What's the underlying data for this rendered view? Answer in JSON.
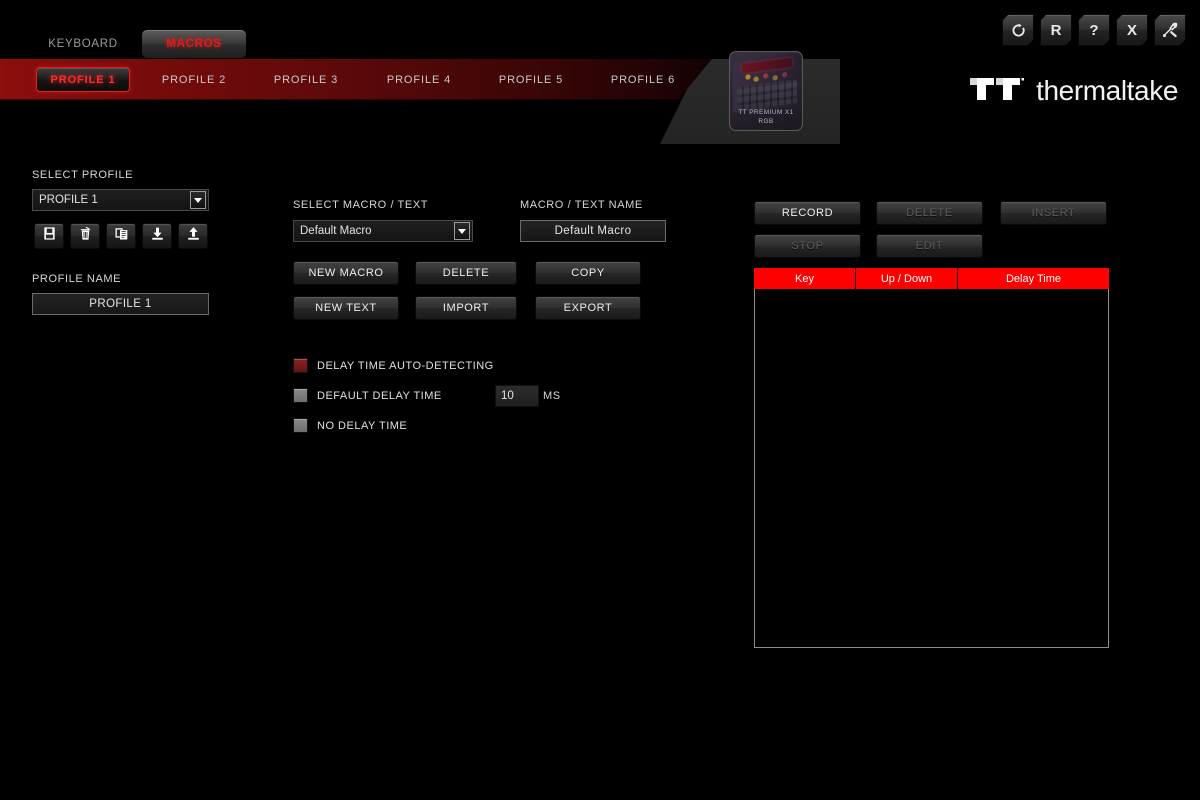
{
  "window_controls": [
    {
      "name": "refresh-button",
      "icon": "refresh-icon",
      "label": ""
    },
    {
      "name": "reset-button",
      "icon": "r-icon",
      "label": "R"
    },
    {
      "name": "help-button",
      "icon": "question-icon",
      "label": "?"
    },
    {
      "name": "close-button",
      "icon": "close-icon",
      "label": "X"
    },
    {
      "name": "settings-button",
      "icon": "tools-icon",
      "label": ""
    }
  ],
  "main_tabs": [
    {
      "label": "KEYBOARD",
      "active": false
    },
    {
      "label": "MACROS",
      "active": true
    }
  ],
  "profile_tabs": [
    {
      "label": "PROFILE 1",
      "active": true
    },
    {
      "label": "PROFILE 2",
      "active": false
    },
    {
      "label": "PROFILE 3",
      "active": false
    },
    {
      "label": "PROFILE 4",
      "active": false
    },
    {
      "label": "PROFILE 5",
      "active": false
    },
    {
      "label": "PROFILE 6",
      "active": false
    }
  ],
  "device": {
    "name_line1": "TT PREMIUM X1",
    "name_line2": "RGB"
  },
  "brand": {
    "name": "thermaltake"
  },
  "profile_panel": {
    "select_label": "SELECT PROFILE",
    "selected_profile": "PROFILE 1",
    "name_label": "PROFILE NAME",
    "name_value": "PROFILE 1",
    "actions": [
      {
        "name": "save-profile-button",
        "icon": "floppy-disk-icon"
      },
      {
        "name": "delete-profile-button",
        "icon": "trash-icon"
      },
      {
        "name": "copy-profile-button",
        "icon": "copy-icon"
      },
      {
        "name": "import-profile-button",
        "icon": "download-icon"
      },
      {
        "name": "export-profile-button",
        "icon": "upload-icon"
      }
    ]
  },
  "macro_panel": {
    "select_label": "SELECT MACRO / TEXT",
    "selected_macro": "Default Macro",
    "name_label": "MACRO / TEXT NAME",
    "name_value": "Default Macro",
    "buttons": [
      {
        "label": "NEW MACRO",
        "disabled": false
      },
      {
        "label": "DELETE",
        "disabled": false
      },
      {
        "label": "COPY",
        "disabled": false
      },
      {
        "label": "NEW TEXT",
        "disabled": false
      },
      {
        "label": "IMPORT",
        "disabled": false
      },
      {
        "label": "EXPORT",
        "disabled": false
      }
    ],
    "delay_options": [
      {
        "label": "DELAY TIME AUTO-DETECTING",
        "selected": true
      },
      {
        "label": "DEFAULT DELAY TIME",
        "selected": false
      },
      {
        "label": "NO DELAY TIME",
        "selected": false
      }
    ],
    "default_delay_value": "10",
    "delay_unit": "MS"
  },
  "record_panel": {
    "buttons": [
      {
        "label": "RECORD",
        "disabled": false
      },
      {
        "label": "DELETE",
        "disabled": true
      },
      {
        "label": "INSERT",
        "disabled": true
      },
      {
        "label": "STOP",
        "disabled": true
      },
      {
        "label": "EDIT",
        "disabled": true
      }
    ],
    "table": {
      "columns": [
        "Key",
        "Up / Down",
        "Delay Time"
      ],
      "rows": [],
      "header_color": "#ff0000"
    }
  },
  "colors": {
    "accent_red": "#e01b1b",
    "table_header": "#ff0000",
    "background": "#000000",
    "profile_bar": "#8e0d0d"
  }
}
